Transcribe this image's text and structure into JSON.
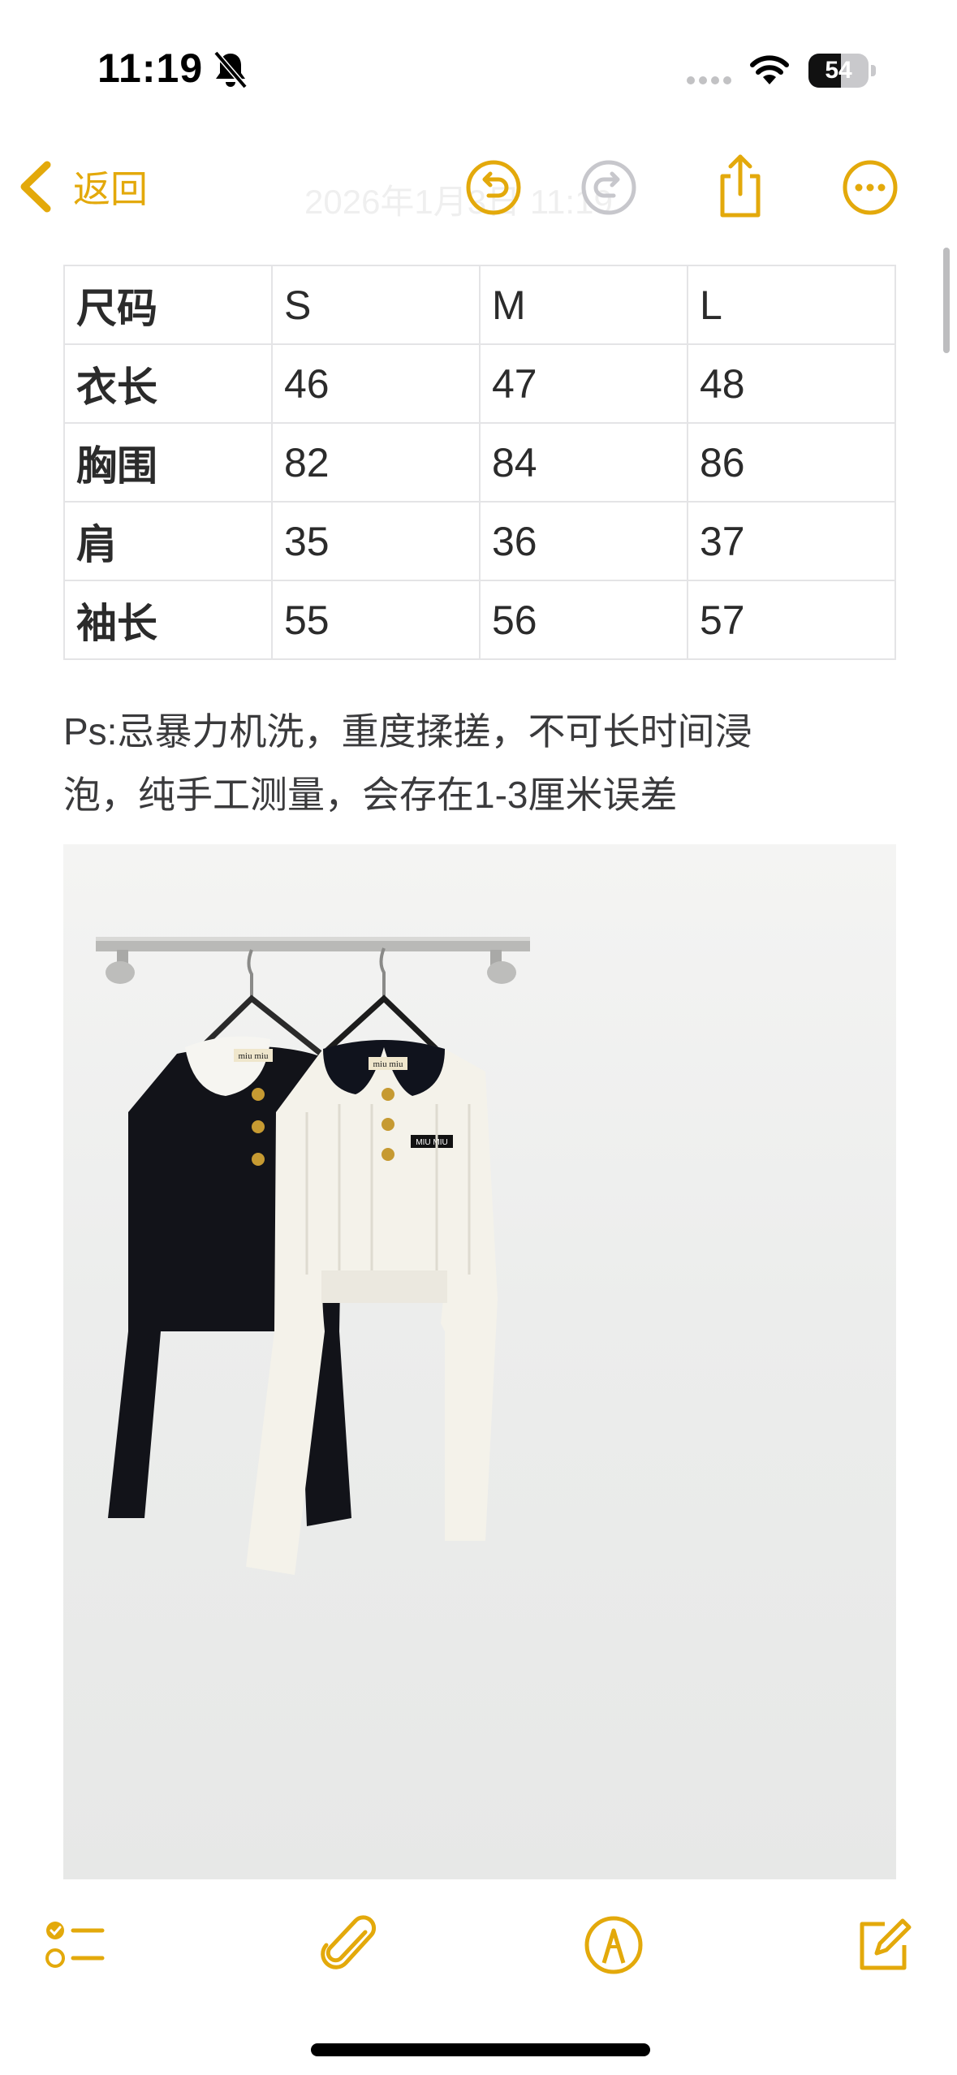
{
  "status_bar": {
    "time": "11:19",
    "battery_level": "54",
    "silent_icon": "bell-slash-icon",
    "wifi_icon": "wifi-icon",
    "cellular_icon": "cellular-dots-icon"
  },
  "nav": {
    "back_label": "返回",
    "faded_title": "2026年1月3日 11:19",
    "icons": [
      "back-chevron-icon",
      "undo-icon",
      "redo-icon",
      "share-icon",
      "more-icon"
    ]
  },
  "size_table": {
    "header": [
      "尺码",
      "S",
      "M",
      "L"
    ],
    "rows": [
      [
        "衣长",
        "46",
        "47",
        "48"
      ],
      [
        "胸围",
        "82",
        "84",
        "86"
      ],
      [
        "肩",
        "35",
        "36",
        "37"
      ],
      [
        "袖长",
        "55",
        "56",
        "57"
      ]
    ]
  },
  "note": {
    "line1": "Ps:忌暴力机洗，重度揉搓，不可长时间浸",
    "line2": "泡，纯手工测量，会存在1-3厘米误差"
  },
  "photo": {
    "label_left": "miu miu",
    "label_right": "miu miu",
    "badge": "MIU MIU"
  },
  "toolbar": {
    "icons": [
      "checklist-icon",
      "paperclip-icon",
      "markup-pen-icon",
      "compose-icon"
    ]
  },
  "colors": {
    "accent": "#e3a90b",
    "disabled": "#c7c7cc",
    "table_border": "#e4e4e6"
  }
}
